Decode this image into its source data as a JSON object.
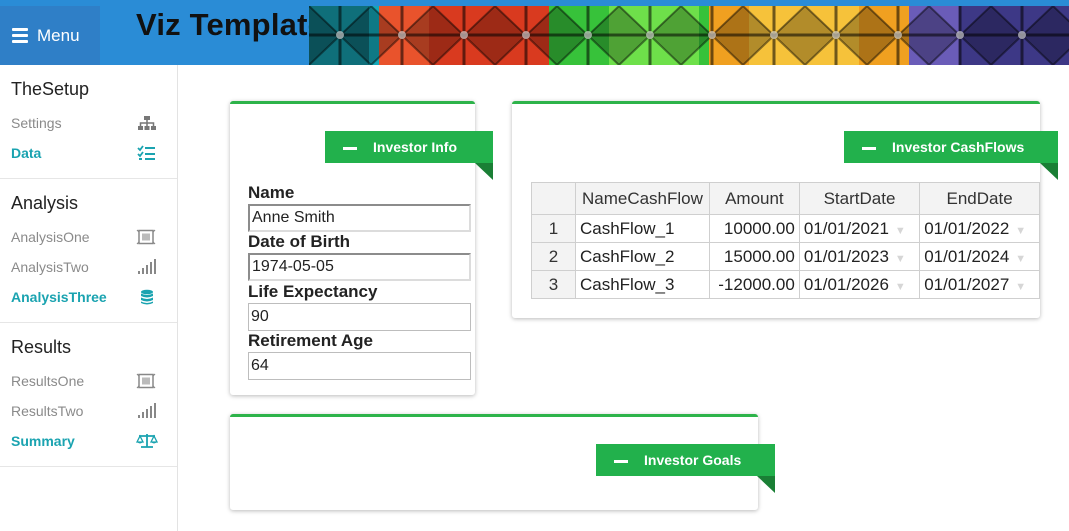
{
  "header": {
    "menu_label": "Menu",
    "brand_title": "Viz Template"
  },
  "sidebar": {
    "sections": [
      {
        "title": "TheSetup",
        "items": [
          {
            "label": "Settings",
            "icon": "sitemap-icon",
            "active": false
          },
          {
            "label": "Data",
            "icon": "list-check-icon",
            "active": true
          }
        ]
      },
      {
        "title": "Analysis",
        "items": [
          {
            "label": "AnalysisOne",
            "icon": "image-frame-icon",
            "active": false
          },
          {
            "label": "AnalysisTwo",
            "icon": "signal-bars-icon",
            "active": false
          },
          {
            "label": "AnalysisThree",
            "icon": "database-icon",
            "active": true
          }
        ]
      },
      {
        "title": "Results",
        "items": [
          {
            "label": "ResultsOne",
            "icon": "image-frame-icon",
            "active": false
          },
          {
            "label": "ResultsTwo",
            "icon": "signal-bars-icon",
            "active": false
          },
          {
            "label": "Summary",
            "icon": "balance-scale-icon",
            "active": true
          }
        ]
      }
    ]
  },
  "investor_info": {
    "ribbon_label": "Investor Info",
    "fields": [
      {
        "label": "Name",
        "value": "Anne Smith"
      },
      {
        "label": "Date of Birth",
        "value": "1974-05-05"
      },
      {
        "label": "Life Expectancy",
        "value": "90"
      },
      {
        "label": "Retirement Age",
        "value": "64"
      }
    ]
  },
  "investor_cashflows": {
    "ribbon_label": "Investor CashFlows",
    "columns": [
      "",
      "NameCashFlow",
      "Amount",
      "StartDate",
      "EndDate"
    ],
    "rows": [
      [
        "1",
        "CashFlow_1",
        "10000.00",
        "01/01/2021",
        "01/01/2022"
      ],
      [
        "2",
        "CashFlow_2",
        "15000.00",
        "01/01/2023",
        "01/01/2024"
      ],
      [
        "3",
        "CashFlow_3",
        "-12000.00",
        "01/01/2026",
        "01/01/2027"
      ]
    ]
  },
  "investor_goals": {
    "ribbon_label": "Investor Goals"
  },
  "colors": {
    "topbar": "#2a8cd6",
    "accent_green": "#22b14c",
    "active_teal": "#1aa3b0"
  }
}
